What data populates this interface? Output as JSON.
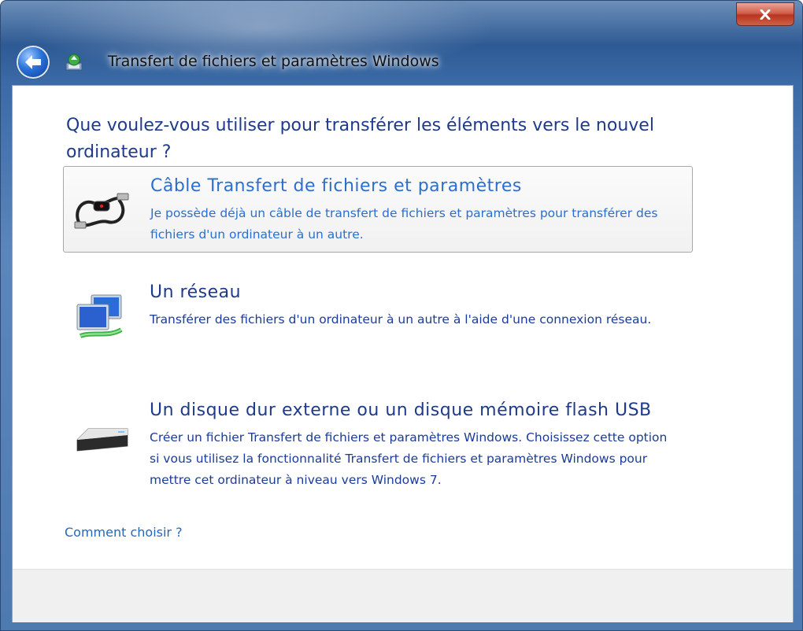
{
  "window": {
    "title": "Transfert de fichiers et paramètres Windows",
    "close_label": "X"
  },
  "main": {
    "question": "Que voulez-vous utiliser pour transférer les éléments vers le nouvel ordinateur ?",
    "options": [
      {
        "title": "Câble Transfert de fichiers et paramètres",
        "description": "Je possède déjà un câble de transfert de fichiers et paramètres pour transférer des fichiers d'un ordinateur à un autre.",
        "icon": "usb-cable-icon",
        "selected": true
      },
      {
        "title": "Un réseau",
        "description": "Transférer des fichiers d'un ordinateur à un autre à l'aide d'une connexion réseau.",
        "icon": "network-icon",
        "selected": false
      },
      {
        "title": "Un disque dur externe ou un disque mémoire flash USB",
        "description": "Créer un fichier Transfert de fichiers et paramètres Windows. Choisissez cette option si vous utilisez la fonctionnalité Transfert de fichiers et paramètres Windows pour mettre cet ordinateur à niveau vers Windows 7.",
        "icon": "external-drive-icon",
        "selected": false
      }
    ],
    "help_link": "Comment choisir ?"
  },
  "colors": {
    "heading": "#1e3a8a",
    "link": "#2468b8",
    "frame": "#3b6aa6"
  }
}
